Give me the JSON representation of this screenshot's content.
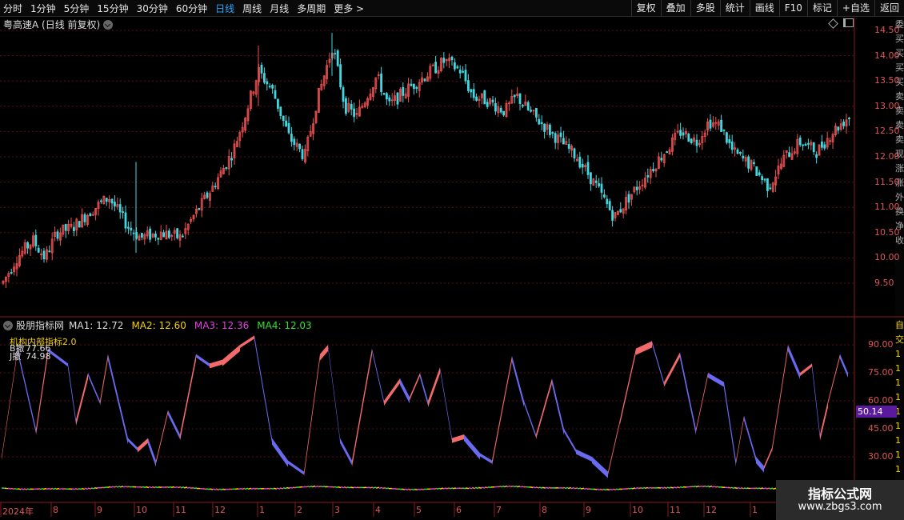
{
  "toolbar": {
    "periods": [
      "分时",
      "1分钟",
      "5分钟",
      "15分钟",
      "30分钟",
      "60分钟",
      "日线",
      "周线",
      "月线",
      "多周期",
      "更多 >"
    ],
    "active_period": "日线",
    "buttons": [
      "复权",
      "叠加",
      "多股",
      "统计",
      "画线",
      "F10",
      "标记",
      "+自选",
      "返回"
    ]
  },
  "main_chart": {
    "title": "粤高速A (日线 前复权)",
    "price_ticks": [
      "14.50",
      "14.00",
      "13.50",
      "13.00",
      "12.50",
      "12.00",
      "11.50",
      "11.00",
      "10.50",
      "10.00",
      "9.50"
    ],
    "up_color": "#f05050",
    "down_color": "#40d8e0",
    "right_strip_chars": [
      "委",
      "买",
      "买",
      "买",
      "买",
      "卖",
      "卖",
      "卖",
      "卖",
      "现",
      "涨",
      "涨",
      "外",
      "换",
      "净",
      "收"
    ]
  },
  "indicator": {
    "name": "股朋指标网",
    "ma1": {
      "label": "MA1: 12.72",
      "color": "#dddddd"
    },
    "ma2": {
      "label": "MA2: 12.60",
      "color": "#f5d000"
    },
    "ma3": {
      "label": "MA3: 12.36",
      "color": "#e040e0"
    },
    "ma4": {
      "label": "MA4: 12.03",
      "color": "#30e030"
    },
    "sub_title": "机构内部指标2.0",
    "line_a": {
      "k": "B撤",
      "v": "77.66"
    },
    "line_b": {
      "k": "J撤",
      "v": "74.98"
    },
    "ticks": [
      "90.00",
      "75.00",
      "60.00",
      "45.00",
      "30.00"
    ],
    "current_value": "50.14",
    "badge_color": "#5a1a9e",
    "right_strip_chars": [
      "自",
      "交",
      "1",
      "1",
      "1",
      "1",
      "1",
      "1",
      "1",
      "1",
      "1",
      "1"
    ]
  },
  "date_axis": [
    "2024年",
    "8",
    "9",
    "10",
    "11",
    "12",
    "1",
    "2",
    "3",
    "4",
    "5",
    "6",
    "7",
    "8",
    "9",
    "10",
    "11",
    "12",
    "1"
  ],
  "watermark": {
    "line1": "指标公式网",
    "line2": "www.zbgs3.com"
  }
}
